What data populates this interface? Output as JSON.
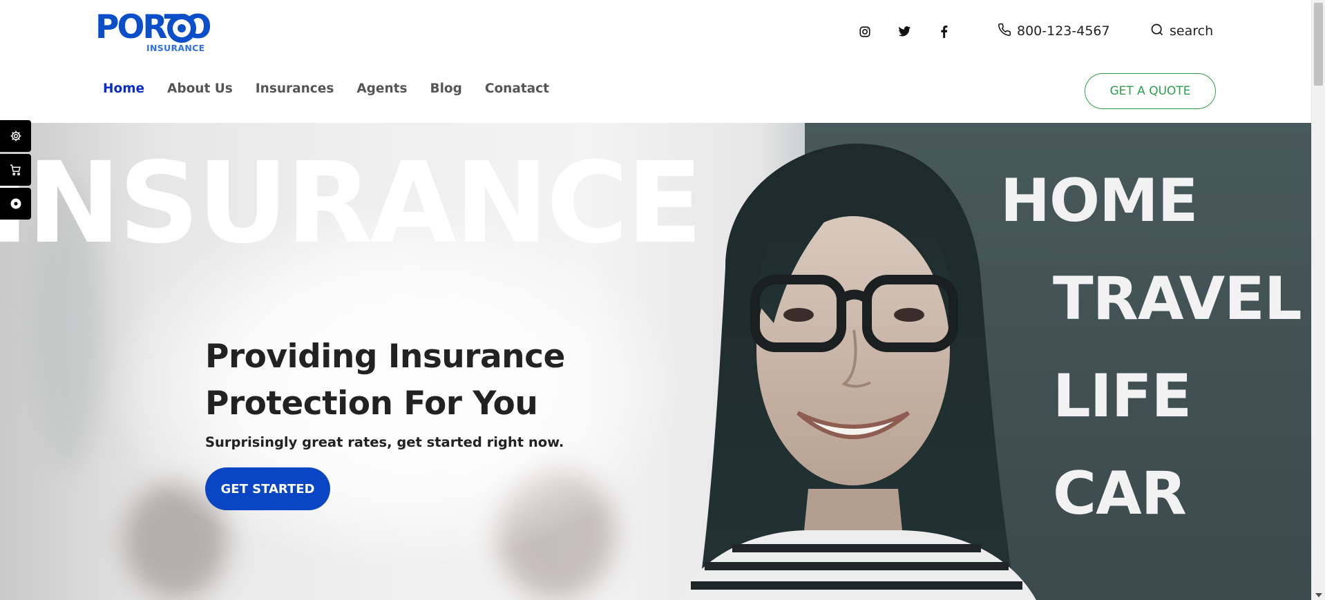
{
  "brand": {
    "name": "PORTO",
    "sub": "INSURANCE",
    "color": "#0a4fc9"
  },
  "header": {
    "social": [
      "instagram-icon",
      "twitter-icon",
      "facebook-icon"
    ],
    "phone": "800-123-4567",
    "search_label": "search"
  },
  "nav": {
    "items": [
      {
        "label": "Home",
        "active": true
      },
      {
        "label": "About Us"
      },
      {
        "label": "Insurances"
      },
      {
        "label": "Agents"
      },
      {
        "label": "Blog"
      },
      {
        "label": "Conatact"
      }
    ],
    "quote_label": "GET A QUOTE"
  },
  "hero": {
    "big_word": "INSURANCE",
    "tags": [
      "HOME",
      "TRAVEL",
      "LIFE",
      "CAR"
    ],
    "title_line1": "Providing Insurance",
    "title_line2": "Protection For You",
    "subtitle": "Surprisingly great rates, get started right now.",
    "cta_label": "GET STARTED"
  },
  "side_tools": [
    "gear-icon",
    "cart-icon",
    "record-icon"
  ],
  "colors": {
    "accent": "#0a45c4",
    "quote": "#2e9e4e",
    "nav_active": "#0b2ccc"
  }
}
